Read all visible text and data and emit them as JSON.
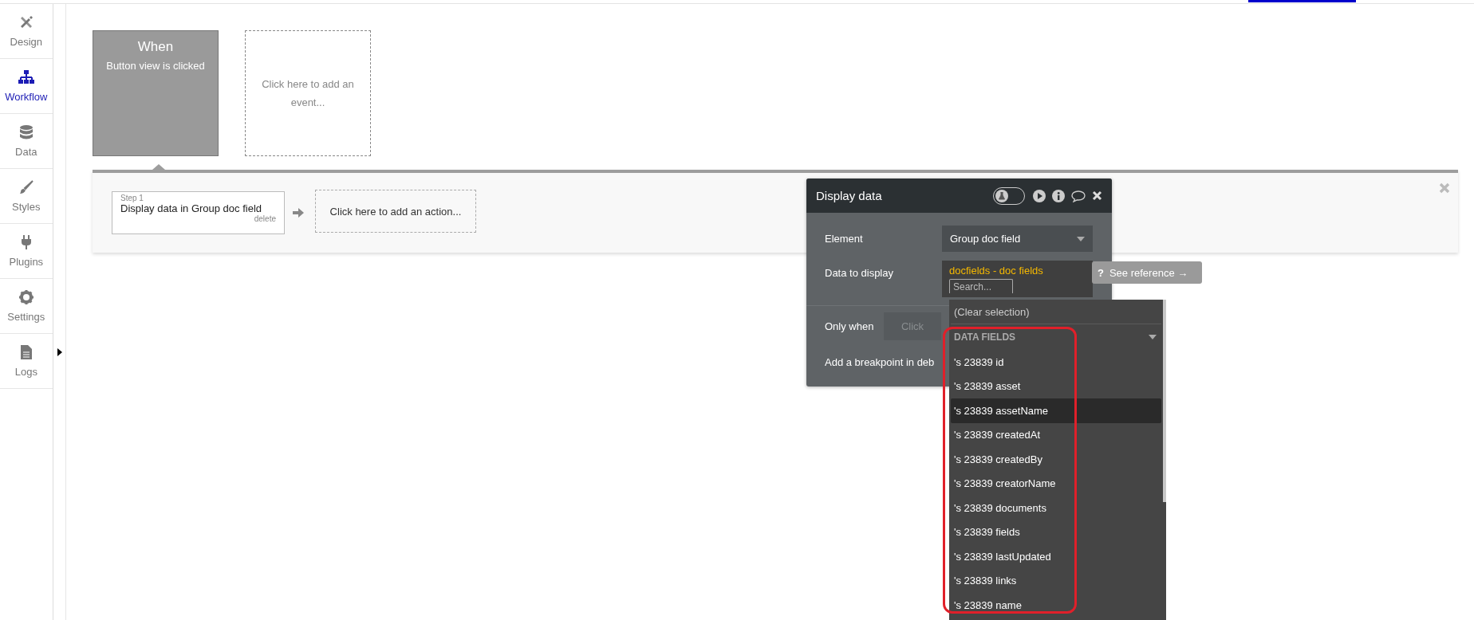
{
  "sidebar": {
    "items": [
      {
        "label": "Design",
        "selected": false
      },
      {
        "label": "Workflow",
        "selected": true
      },
      {
        "label": "Data",
        "selected": false
      },
      {
        "label": "Styles",
        "selected": false
      },
      {
        "label": "Plugins",
        "selected": false
      },
      {
        "label": "Settings",
        "selected": false
      },
      {
        "label": "Logs",
        "selected": false
      }
    ]
  },
  "events": [
    {
      "kind": "event",
      "title": "When",
      "subtitle": "Button view is clicked"
    },
    {
      "kind": "add",
      "text": "Click here to add an event..."
    }
  ],
  "actions": {
    "steps": [
      {
        "step": "Step 1",
        "title": "Display data in Group doc field",
        "delete": "delete"
      }
    ],
    "add_action": "Click here to add an action..."
  },
  "panel": {
    "title": "Display data",
    "debug_toggle_on": false,
    "element": {
      "label": "Element",
      "value": "Group doc field"
    },
    "data_to_display": {
      "label": "Data to display",
      "value": "docfields - doc fields",
      "search_placeholder": "Search..."
    },
    "see_reference": {
      "icon": "?",
      "text": "See reference →"
    },
    "only_when": {
      "label": "Only when",
      "placeholder": "Click"
    },
    "breakpoint": "Add a breakpoint in deb",
    "dropdown": {
      "clear": "(Clear selection)",
      "section": "DATA FIELDS",
      "items": [
        {
          "label": "'s 23839 id",
          "selected": false
        },
        {
          "label": "'s 23839 asset",
          "selected": false
        },
        {
          "label": "'s 23839 assetName",
          "selected": true
        },
        {
          "label": "'s 23839 createdAt",
          "selected": false
        },
        {
          "label": "'s 23839 createdBy",
          "selected": false
        },
        {
          "label": "'s 23839 creatorName",
          "selected": false
        },
        {
          "label": "'s 23839 documents",
          "selected": false
        },
        {
          "label": "'s 23839 fields",
          "selected": false
        },
        {
          "label": "'s 23839 lastUpdated",
          "selected": false
        },
        {
          "label": "'s 23839 links",
          "selected": false
        },
        {
          "label": "'s 23839 name",
          "selected": false
        }
      ]
    }
  }
}
